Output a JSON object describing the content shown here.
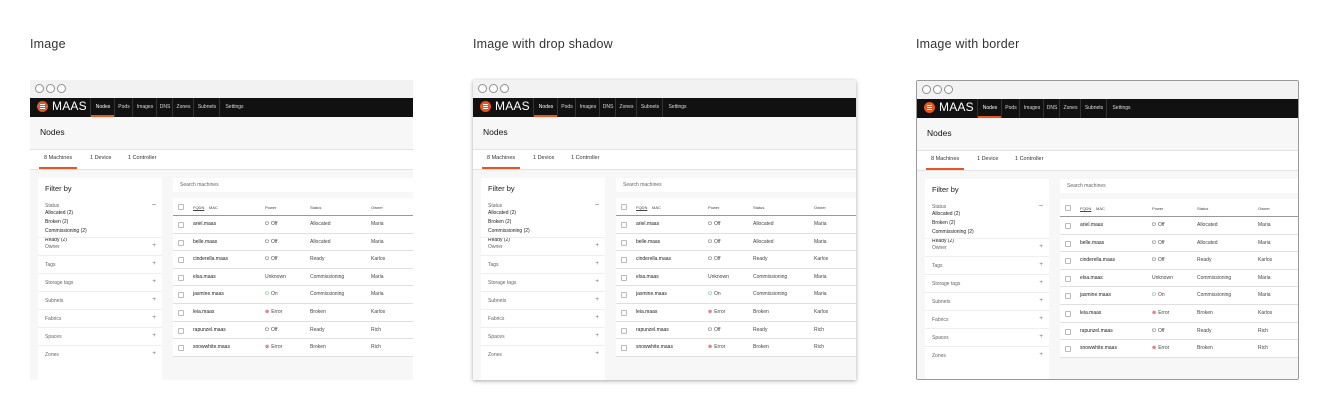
{
  "panels": [
    {
      "title": "Image"
    },
    {
      "title": "Image with drop shadow"
    },
    {
      "title": "Image with border"
    }
  ],
  "app": {
    "brand": "MAAS",
    "nav": [
      "Nodes",
      "Pods",
      "Images",
      "DNS",
      "Zones",
      "Subnets",
      "Settings"
    ],
    "active_nav": "Nodes",
    "page_title": "Nodes",
    "tabs": [
      "8 Machines",
      "1 Device",
      "1 Controller"
    ],
    "active_tab": "8 Machines",
    "filter": {
      "title": "Filter by",
      "status_label": "Status",
      "status_options": [
        "Allocated (2)",
        "Broken (2)",
        "Commissioning (2)",
        "Ready (2)"
      ],
      "facets": [
        "Owner",
        "Tags",
        "Storage tags",
        "Subnets",
        "Fabrics",
        "Spaces",
        "Zones"
      ]
    },
    "search_placeholder": "Search machines",
    "columns": {
      "fqdn": "FQDN",
      "mac": "MAC",
      "power": "Power",
      "status": "Status",
      "owner": "Owner"
    },
    "machines": [
      {
        "fqdn": "ariel.maas",
        "power": "Off",
        "power_state": "off",
        "status": "Allocated",
        "owner": "Maria"
      },
      {
        "fqdn": "belle.maas",
        "power": "Off",
        "power_state": "off",
        "status": "Allocated",
        "owner": "Maria"
      },
      {
        "fqdn": "cinderella.maas",
        "power": "Off",
        "power_state": "off",
        "status": "Ready",
        "owner": "Karlos"
      },
      {
        "fqdn": "elsa.maas",
        "power": "Unknown",
        "power_state": "unknown",
        "status": "Commissioning",
        "owner": "Maria"
      },
      {
        "fqdn": "jasmine.maas",
        "power": "On",
        "power_state": "on",
        "status": "Commissioning",
        "owner": "Maria"
      },
      {
        "fqdn": "leia.maas",
        "power": "Error",
        "power_state": "error",
        "status": "Broken",
        "owner": "Karlos"
      },
      {
        "fqdn": "rapunzel.maas",
        "power": "Off",
        "power_state": "off",
        "status": "Ready",
        "owner": "Rich"
      },
      {
        "fqdn": "snowwhite.maas",
        "power": "Error",
        "power_state": "error",
        "status": "Broken",
        "owner": "Rich"
      }
    ]
  },
  "colors": {
    "accent": "#e95420",
    "navbar": "#111111",
    "power_on": "#38b44a",
    "power_error": "#c7162b"
  }
}
